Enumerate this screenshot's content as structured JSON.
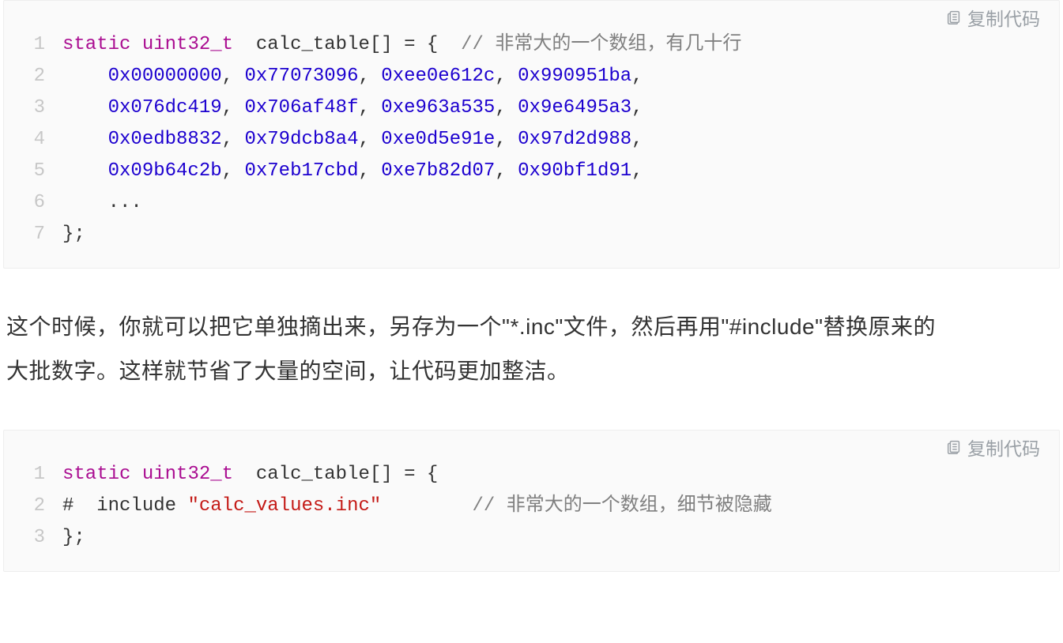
{
  "copy_label": "复制代码",
  "paragraph": "这个时候，你就可以把它单独摘出来，另存为一个\"*.inc\"文件，然后再用\"#include\"替换原来的大批数字。这样就节省了大量的空间，让代码更加整洁。",
  "block1": {
    "l1": {
      "kw": "static",
      "type": "uint32_t",
      "ident": "calc_table",
      "brackets": "[] = {",
      "comment": "// 非常大的一个数组，有几十行"
    },
    "l2": {
      "h0": "0x00000000",
      "h1": "0x77073096",
      "h2": "0xee0e612c",
      "h3": "0x990951ba"
    },
    "l3": {
      "h0": "0x076dc419",
      "h1": "0x706af48f",
      "h2": "0xe963a535",
      "h3": "0x9e6495a3"
    },
    "l4": {
      "h0": "0x0edb8832",
      "h1": "0x79dcb8a4",
      "h2": "0xe0d5e91e",
      "h3": "0x97d2d988"
    },
    "l5": {
      "h0": "0x09b64c2b",
      "h1": "0x7eb17cbd",
      "h2": "0xe7b82d07",
      "h3": "0x90bf1d91"
    },
    "l6": {
      "dots": "..."
    },
    "l7": {
      "end": "};"
    }
  },
  "block2": {
    "l1": {
      "kw": "static",
      "type": "uint32_t",
      "ident": "calc_table",
      "brackets": "[] = {"
    },
    "l2": {
      "hash": "#",
      "inc": "include",
      "str": "\"calc_values.inc\"",
      "comment": "// 非常大的一个数组，细节被隐藏"
    },
    "l3": {
      "end": "};"
    }
  }
}
